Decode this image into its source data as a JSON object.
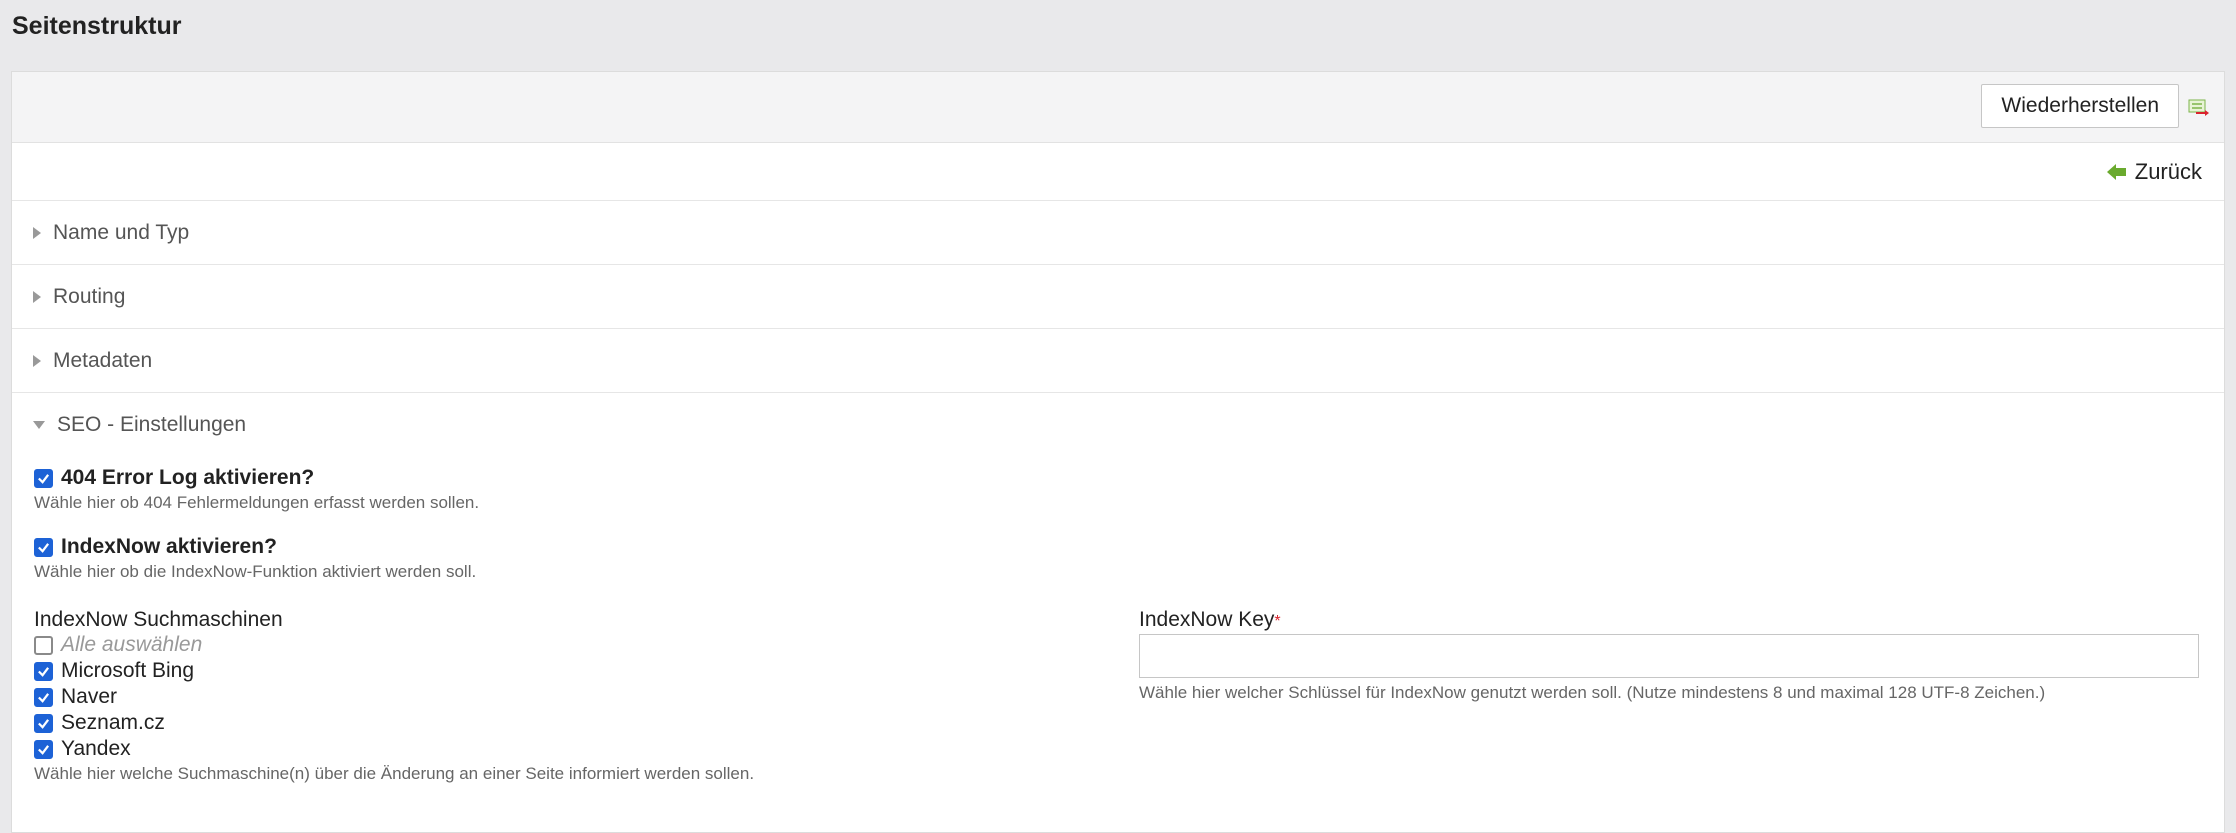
{
  "page": {
    "title": "Seitenstruktur"
  },
  "toolbar": {
    "restore_label": "Wiederherstellen",
    "export_icon": "export-icon"
  },
  "nav": {
    "back_label": "Zurück",
    "back_icon": "arrow-left-icon",
    "back_icon_color": "#6aaa2e"
  },
  "sections": [
    {
      "label": "Name und Typ",
      "expanded": false
    },
    {
      "label": "Routing",
      "expanded": false
    },
    {
      "label": "Metadaten",
      "expanded": false
    },
    {
      "label": "SEO - Einstellungen",
      "expanded": true
    }
  ],
  "seo": {
    "error_log": {
      "label": "404 Error Log aktivieren?",
      "checked": true,
      "help": "Wähle hier ob 404 Fehlermeldungen erfasst werden sollen."
    },
    "indexnow": {
      "label": "IndexNow aktivieren?",
      "checked": true,
      "help": "Wähle hier ob die IndexNow-Funktion aktiviert werden soll."
    },
    "engines": {
      "title": "IndexNow Suchmaschinen",
      "select_all": {
        "label": "Alle auswählen",
        "checked": false
      },
      "items": [
        {
          "label": "Microsoft Bing",
          "checked": true
        },
        {
          "label": "Naver",
          "checked": true
        },
        {
          "label": "Seznam.cz",
          "checked": true
        },
        {
          "label": "Yandex",
          "checked": true
        }
      ],
      "help": "Wähle hier welche Suchmaschine(n) über die Änderung an einer Seite informiert werden sollen."
    },
    "key": {
      "title": "IndexNow Key",
      "required_mark": "*",
      "value": "",
      "help": "Wähle hier welcher Schlüssel für IndexNow genutzt werden soll. (Nutze mindestens 8 und maximal 128 UTF-8 Zeichen.)"
    }
  },
  "colors": {
    "accent": "#1d62d6",
    "required": "#d9232d"
  }
}
